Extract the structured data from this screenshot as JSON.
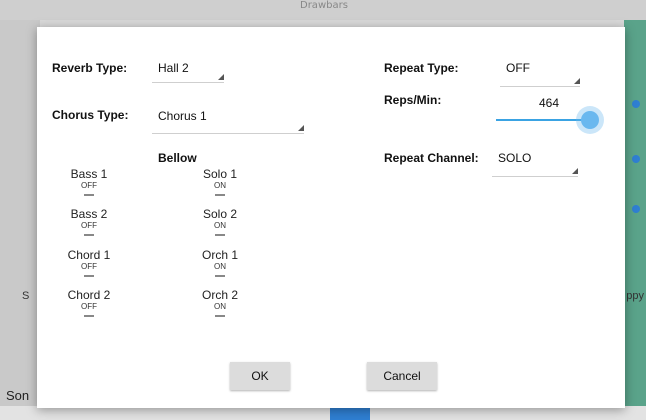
{
  "background": {
    "title": "Drawbars",
    "left_label": "S",
    "right_label": "ppy",
    "bottom_left_label": "Son"
  },
  "dialog": {
    "reverb": {
      "label": "Reverb Type:",
      "value": "Hall 2"
    },
    "chorus": {
      "label": "Chorus Type:",
      "value": "Chorus 1"
    },
    "bellow": {
      "heading": "Bellow",
      "left": [
        {
          "name": "Bass 1",
          "state": "OFF"
        },
        {
          "name": "Bass 2",
          "state": "OFF"
        },
        {
          "name": "Chord 1",
          "state": "OFF"
        },
        {
          "name": "Chord 2",
          "state": "OFF"
        }
      ],
      "right": [
        {
          "name": "Solo 1",
          "state": "ON"
        },
        {
          "name": "Solo 2",
          "state": "ON"
        },
        {
          "name": "Orch 1",
          "state": "ON"
        },
        {
          "name": "Orch 2",
          "state": "ON"
        }
      ]
    },
    "repeat_type": {
      "label": "Repeat Type:",
      "value": "OFF"
    },
    "reps_min": {
      "label": "Reps/Min:",
      "value": "464",
      "slider_level": 1.0
    },
    "repeat_channel": {
      "label": "Repeat Channel:",
      "value": "SOLO"
    },
    "buttons": {
      "ok": "OK",
      "cancel": "Cancel"
    },
    "colors": {
      "accent": "#3aa3e3",
      "button_bg": "#dcdcdc"
    }
  }
}
